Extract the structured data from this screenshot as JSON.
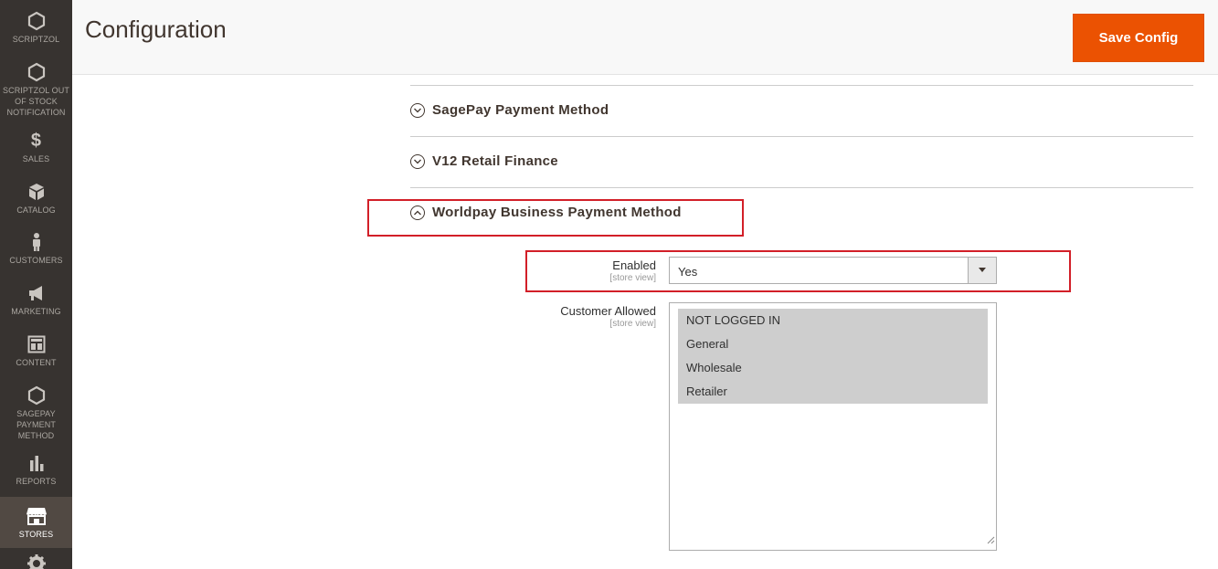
{
  "sidebar": {
    "items": [
      {
        "label": "SCRIPTZOL",
        "icon": "hexagon-icon"
      },
      {
        "label": "SCRIPTZOL OUT OF STOCK NOTIFICATION",
        "icon": "hexagon-icon"
      },
      {
        "label": "SALES",
        "icon": "dollar-icon"
      },
      {
        "label": "CATALOG",
        "icon": "cube-icon"
      },
      {
        "label": "CUSTOMERS",
        "icon": "person-icon"
      },
      {
        "label": "MARKETING",
        "icon": "megaphone-icon"
      },
      {
        "label": "CONTENT",
        "icon": "layout-icon"
      },
      {
        "label": "SAGEPAY PAYMENT METHOD",
        "icon": "hexagon-icon"
      },
      {
        "label": "REPORTS",
        "icon": "bar-chart-icon"
      },
      {
        "label": "STORES",
        "icon": "store-icon",
        "active": true
      },
      {
        "label": "",
        "icon": "gear-icon"
      }
    ]
  },
  "header": {
    "title": "Configuration",
    "save_label": "Save Config",
    "accent_color": "#eb5202"
  },
  "sections": [
    {
      "title": "SagePay Payment Method",
      "state": "collapsed"
    },
    {
      "title": "V12 Retail Finance",
      "state": "collapsed"
    },
    {
      "title": "Worldpay Business Payment Method",
      "state": "expanded"
    }
  ],
  "fields": {
    "enabled": {
      "label": "Enabled",
      "scope": "[store view]",
      "value": "Yes"
    },
    "customer_allowed": {
      "label": "Customer Allowed",
      "scope": "[store view]",
      "options": [
        "NOT LOGGED IN",
        "General",
        "Wholesale",
        "Retailer"
      ]
    }
  },
  "highlight_color": "#d21f28"
}
